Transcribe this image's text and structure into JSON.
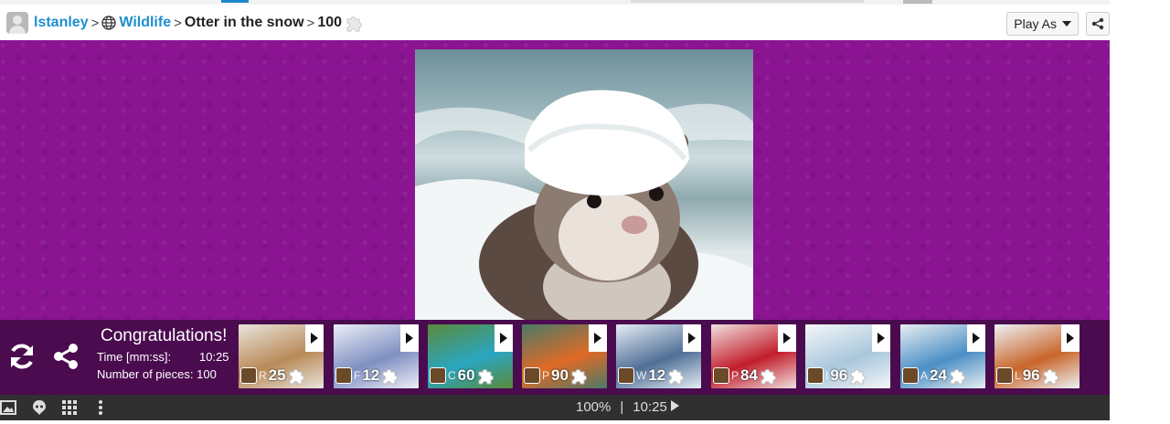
{
  "breadcrumb": {
    "user": "lstanley",
    "category": "Wildlife",
    "puzzle": "Otter in the snow",
    "pieces": "100"
  },
  "toolbar": {
    "play_as": "Play As"
  },
  "result": {
    "title": "Congratulations!",
    "time_label": "Time [mm:ss]:",
    "time_value": "10:25",
    "pieces_label": "Number of pieces:",
    "pieces_value": "100"
  },
  "related": [
    {
      "letter": "R",
      "count": "25",
      "theme": "fox",
      "colors": [
        "#b98a58",
        "#e9e4dc"
      ]
    },
    {
      "letter": "F",
      "count": "12",
      "theme": "bears",
      "colors": [
        "#7f8fc1",
        "#eceff7"
      ]
    },
    {
      "letter": "C",
      "count": "60",
      "theme": "lake",
      "colors": [
        "#2aa6c2",
        "#5a8a3a"
      ]
    },
    {
      "letter": "P",
      "count": "90",
      "theme": "robin",
      "colors": [
        "#e06a25",
        "#4a7a6a"
      ]
    },
    {
      "letter": "W",
      "count": "12",
      "theme": "horse",
      "colors": [
        "#4f6f96",
        "#e6edf5"
      ]
    },
    {
      "letter": "P",
      "count": "84",
      "theme": "christmas",
      "colors": [
        "#c21d2a",
        "#f0e0e0"
      ]
    },
    {
      "letter": "I",
      "count": "96",
      "theme": "polar-cubs",
      "colors": [
        "#a9c7dc",
        "#f4f6f8"
      ]
    },
    {
      "letter": "A",
      "count": "24",
      "theme": "polar-bear",
      "colors": [
        "#4b8fc5",
        "#e9eef2"
      ]
    },
    {
      "letter": "L",
      "count": "96",
      "theme": "snow-fox",
      "colors": [
        "#c9652a",
        "#eef2f6"
      ]
    }
  ],
  "status": {
    "zoom": "100%",
    "separator": "|",
    "time": "10:25"
  }
}
